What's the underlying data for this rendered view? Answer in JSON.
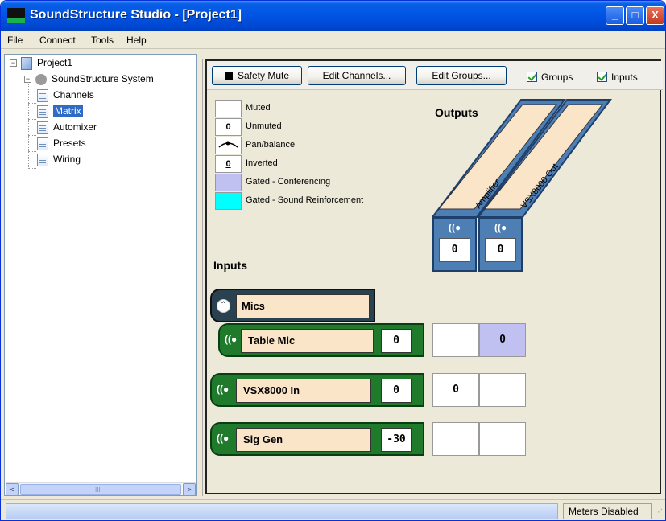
{
  "window": {
    "title": "SoundStructure Studio - [Project1]",
    "min_label": "_",
    "max_label": "□",
    "close_label": "X"
  },
  "menu": [
    "File",
    "Connect",
    "Tools",
    "Help"
  ],
  "tree": {
    "root": "Project1",
    "system": "SoundStructure System",
    "items": [
      "Channels",
      "Matrix",
      "Automixer",
      "Presets",
      "Wiring"
    ],
    "selected": "Matrix",
    "scroll_left": "<",
    "scroll_right": ">",
    "scroll_grip": "III"
  },
  "toolbar": {
    "safety_mute": "Safety Mute",
    "edit_channels": "Edit Channels...",
    "edit_groups": "Edit Groups...",
    "groups": "Groups",
    "inputs": "Inputs"
  },
  "legend": [
    {
      "symbol": "",
      "label": "Muted",
      "color": "#ffffff"
    },
    {
      "symbol": "0",
      "label": "Unmuted",
      "color": "#ffffff"
    },
    {
      "symbol": "pan-arc-icon",
      "label": "Pan/balance",
      "color": "#ffffff"
    },
    {
      "symbol": "0",
      "label": "Inverted",
      "color": "#ffffff"
    },
    {
      "symbol": "",
      "label": "Gated - Conferencing",
      "color": "#c1c1f1"
    },
    {
      "symbol": "",
      "label": "Gated - Sound Reinforcement",
      "color": "#00ffff"
    }
  ],
  "headings": {
    "outputs": "Outputs",
    "inputs": "Inputs"
  },
  "outputs": [
    {
      "name": "Amplifier",
      "value": "0",
      "icon": "wave-icon",
      "icon_text": "((●"
    },
    {
      "name": "VSX8000 Out",
      "value": "0",
      "icon": "wave-icon",
      "icon_text": "((●"
    }
  ],
  "group": {
    "name": "Mics",
    "collapse_icon_text": "⌃"
  },
  "inputs": [
    {
      "name": "Table Mic",
      "value": "0",
      "icon_text": "((●",
      "cells": [
        {
          "value": "",
          "state": "muted"
        },
        {
          "value": "0",
          "state": "gated-conf"
        }
      ]
    },
    {
      "name": "VSX8000 In",
      "value": "0",
      "icon_text": "((●",
      "cells": [
        {
          "value": "0",
          "state": "unmuted"
        },
        {
          "value": "",
          "state": "muted"
        }
      ]
    },
    {
      "name": "Sig Gen",
      "value": "-30",
      "icon_text": "((●",
      "cells": [
        {
          "value": "",
          "state": "muted"
        },
        {
          "value": "",
          "state": "muted"
        }
      ]
    }
  ],
  "status": {
    "meters": "Meters Disabled",
    "grip": "⋰"
  }
}
